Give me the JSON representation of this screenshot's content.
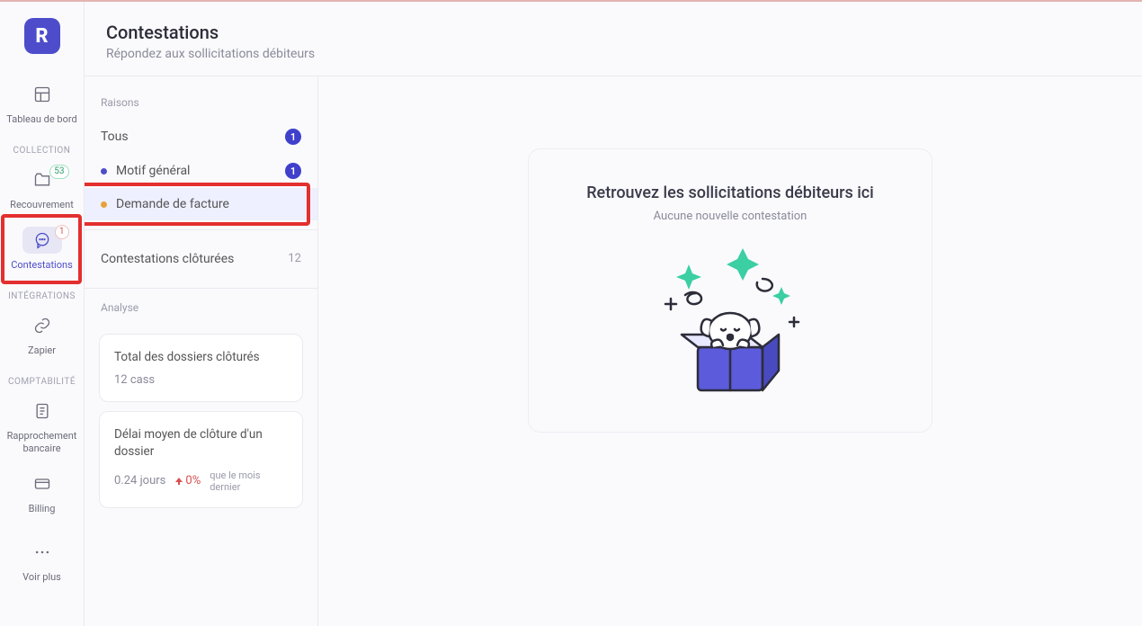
{
  "logo_text": "R",
  "sidebar": {
    "items": [
      {
        "label": "Tableau de bord"
      },
      {
        "section": "COLLECTION"
      },
      {
        "label": "Recouvrement",
        "badge": "53"
      },
      {
        "label": "Contestations",
        "badge": "1",
        "active": true
      },
      {
        "section": "INTÉGRATIONS"
      },
      {
        "label": "Zapier"
      },
      {
        "section": "COMPTABILITÉ"
      },
      {
        "label": "Rapprochement\nbancaire"
      },
      {
        "label": "Billing"
      },
      {
        "label": "Voir plus"
      }
    ]
  },
  "header": {
    "title": "Contestations",
    "subtitle": "Répondez aux sollicitations débiteurs"
  },
  "panel": {
    "reasons_label": "Raisons",
    "all_label": "Tous",
    "all_count": "1",
    "reasons": [
      {
        "name": "Motif général",
        "count": "1",
        "color": "#4d4dcc"
      },
      {
        "name": "Demande de facture",
        "color": "#e8a13a"
      }
    ],
    "closed_label": "Contestations clôturées",
    "closed_count": "12",
    "analysis_label": "Analyse",
    "card1": {
      "title": "Total des dossiers clôturés",
      "value": "12 cass"
    },
    "card2": {
      "title": "Délai moyen de clôture d'un dossier",
      "value": "0.24 jours",
      "delta": "0%",
      "delta_sub": "que le mois dernier"
    }
  },
  "empty": {
    "title": "Retrouvez les sollicitations débiteurs ici",
    "subtitle": "Aucune nouvelle contestation"
  }
}
